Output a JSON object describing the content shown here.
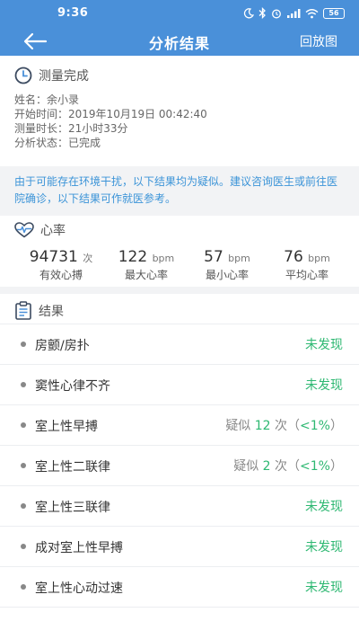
{
  "status_bar": {
    "time": "9:36",
    "battery": "56"
  },
  "nav": {
    "title": "分析结果",
    "right_action": "回放图"
  },
  "measurement": {
    "section_title": "测量完成",
    "name_label": "姓名：",
    "name_value": "余小录",
    "start_label": "开始时间：",
    "start_value": "2019年10月19日 00:42:40",
    "duration_label": "测量时长：",
    "duration_value": "21小时33分",
    "state_label": "分析状态：",
    "state_value": "已完成"
  },
  "notice": "由于可能存在环境干扰，以下结果均为疑似。建议咨询医生或前往医院确诊，以下结果可作就医参考。",
  "heart_rate": {
    "section_title": "心率",
    "stats": [
      {
        "value": "94731",
        "unit": "次",
        "label": "有效心搏"
      },
      {
        "value": "122",
        "unit": "bpm",
        "label": "最大心率"
      },
      {
        "value": "57",
        "unit": "bpm",
        "label": "最小心率"
      },
      {
        "value": "76",
        "unit": "bpm",
        "label": "平均心率"
      }
    ]
  },
  "results": {
    "section_title": "结果",
    "items": [
      {
        "name": "房颤/房扑",
        "status": "未发现"
      },
      {
        "name": "窦性心律不齐",
        "status": "未发现"
      },
      {
        "name": "室上性早搏",
        "prefix": "疑似",
        "count": "12",
        "suffix": "次（",
        "pct": "<1%",
        "close": "）"
      },
      {
        "name": "室上性二联律",
        "prefix": "疑似",
        "count": "2",
        "suffix": "次（",
        "pct": "<1%",
        "close": "）"
      },
      {
        "name": "室上性三联律",
        "status": "未发现"
      },
      {
        "name": "成对室上性早搏",
        "status": "未发现"
      },
      {
        "name": "室上性心动过速",
        "status": "未发现"
      }
    ]
  },
  "colors": {
    "header": "#4a90d9",
    "found_none": "#2eb872",
    "notice": "#3c94d8"
  }
}
